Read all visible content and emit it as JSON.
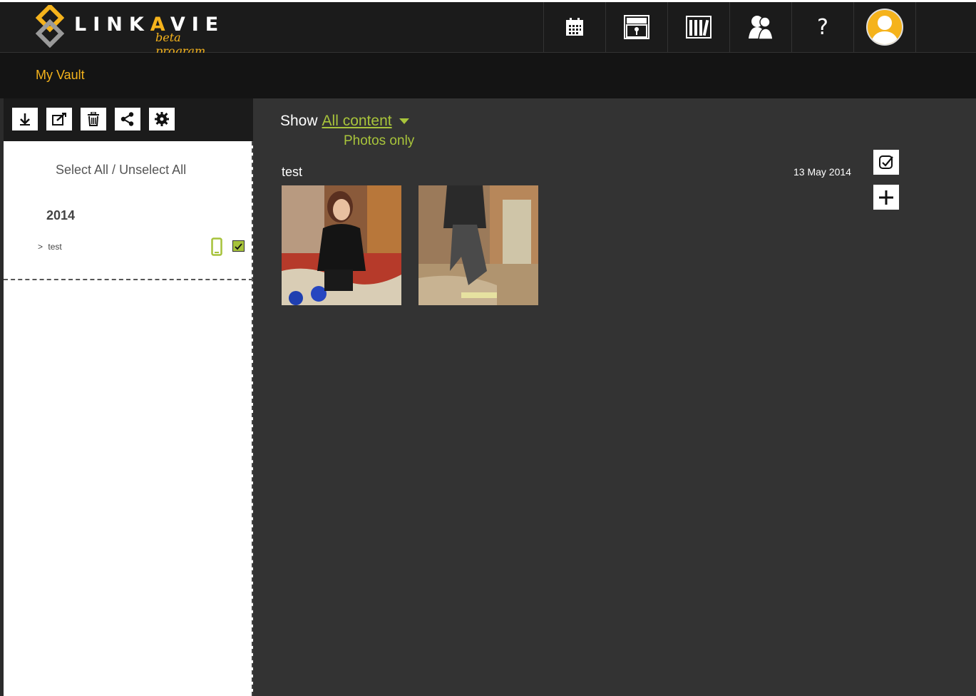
{
  "brand": {
    "name_part1": "LINK",
    "name_hl": "A",
    "name_part2": "VIE",
    "tagline": "beta program"
  },
  "nav": {
    "items": [
      {
        "name": "calendar-icon"
      },
      {
        "name": "vault-icon"
      },
      {
        "name": "library-icon"
      },
      {
        "name": "contacts-icon"
      },
      {
        "name": "help-icon",
        "label": "?"
      },
      {
        "name": "profile-avatar"
      }
    ]
  },
  "header": {
    "title": "My Vault"
  },
  "sidebar": {
    "select_all": "Select All",
    "separator": " / ",
    "unselect_all": "Unselect All",
    "year": "2014",
    "album": {
      "prefix": ">",
      "label": "test",
      "checked": true
    }
  },
  "main": {
    "show_label": "Show",
    "filter_value": "All content",
    "filter_option": "Photos only",
    "album_title": "test",
    "album_date": "13 May 2014"
  },
  "colors": {
    "accent_yellow": "#f5b31c",
    "accent_green": "#a8c43b",
    "bg_dark": "#1b1b1b",
    "bg_main": "#333333"
  }
}
